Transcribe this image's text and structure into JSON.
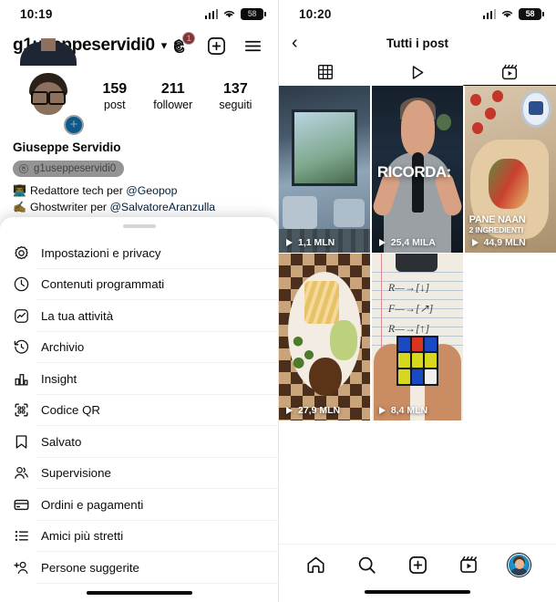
{
  "left_phone": {
    "status_bar": {
      "time": "10:19",
      "battery": "58",
      "wifi_icon": "wifi-icon",
      "signal_icon": "cellular-signal-icon"
    },
    "profile": {
      "username": "g1usepeservidi0",
      "username_display": "g1useppeservidi0",
      "chevron": "⌄",
      "threads_badge": "1",
      "stats": [
        {
          "number": "159",
          "label": "post"
        },
        {
          "number": "211",
          "label": "follower"
        },
        {
          "number": "137",
          "label": "seguiti"
        }
      ],
      "full_name": "Giuseppe Servidio",
      "threads_chip": "g1useppeservidi0",
      "bio": [
        {
          "emoji": "👨‍💻",
          "text": "Redattore tech per ",
          "mention": "@Geopop"
        },
        {
          "emoji": "✍️",
          "text": "Ghostwriter per ",
          "mention": "@SalvatoreAranzulla"
        }
      ]
    },
    "sheet": {
      "items": [
        {
          "label": "Impostazioni e privacy",
          "icon": "settings-gear-icon"
        },
        {
          "label": "Contenuti programmati",
          "icon": "clock-icon"
        },
        {
          "label": "La tua attività",
          "icon": "activity-chart-icon"
        },
        {
          "label": "Archivio",
          "icon": "archive-clock-icon"
        },
        {
          "label": "Insight",
          "icon": "insights-bar-icon"
        },
        {
          "label": "Codice QR",
          "icon": "qr-code-icon"
        },
        {
          "label": "Salvato",
          "icon": "bookmark-icon"
        },
        {
          "label": "Supervisione",
          "icon": "supervision-people-icon"
        },
        {
          "label": "Ordini e pagamenti",
          "icon": "credit-card-icon"
        },
        {
          "label": "Amici più stretti",
          "icon": "close-friends-list-icon"
        },
        {
          "label": "Persone suggerite",
          "icon": "add-person-icon"
        }
      ]
    }
  },
  "right_phone": {
    "status_bar": {
      "time": "10:20",
      "battery": "58",
      "wifi_icon": "wifi-icon",
      "signal_icon": "cellular-signal-icon"
    },
    "nav": {
      "back_icon": "back-chevron-icon",
      "title": "Tutti i post"
    },
    "tabs": [
      {
        "icon": "grid-icon",
        "active": false
      },
      {
        "icon": "play-triangle-icon",
        "active": false
      },
      {
        "icon": "reels-icon",
        "active": true
      }
    ],
    "grid": [
      {
        "views": "1,1 MLN",
        "caption_big": "",
        "caption_small": "",
        "caption_center": "",
        "art": "th1"
      },
      {
        "views": "25,4 MILA",
        "caption_big": "",
        "caption_small": "",
        "caption_center": "RICORDA:",
        "art": "th2"
      },
      {
        "views": "44,9 MLN",
        "caption_big": "PANE NAAN",
        "caption_small": "2 INGREDIENTI",
        "caption_center": "",
        "art": "th3"
      },
      {
        "views": "27,9 MLN",
        "caption_big": "",
        "caption_small": "",
        "caption_center": "",
        "art": "th4"
      },
      {
        "views": "8,4 MLN",
        "caption_big": "",
        "caption_small": "",
        "caption_center": "",
        "art": "th5"
      }
    ],
    "tabbar": [
      {
        "icon": "home-icon"
      },
      {
        "icon": "search-icon"
      },
      {
        "icon": "create-plus-icon"
      },
      {
        "icon": "reels-icon"
      },
      {
        "icon": "profile-avatar-icon"
      }
    ]
  },
  "colors": {
    "accent_blue": "#0095F6",
    "badge_red": "#ED4956",
    "text_primary": "#0b0b0b",
    "divider": "#EFEFEF",
    "chip_bg": "#EFEFEF",
    "mention_blue": "#00376B"
  }
}
